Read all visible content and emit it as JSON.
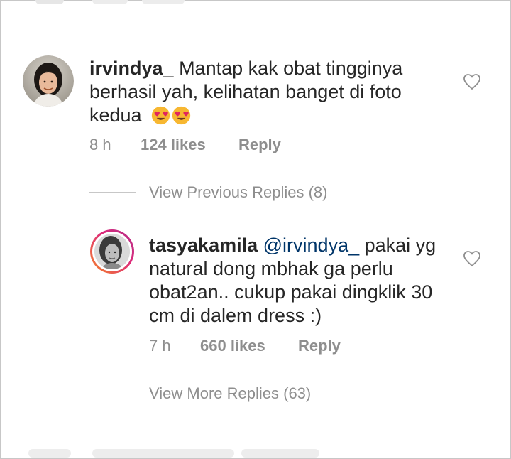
{
  "comments": [
    {
      "username": "irvindya_",
      "text_line1": " Mantap kak obat tingginya",
      "text_line2": "berhasil yah, kelihatan banget di foto",
      "text_line3": "kedua",
      "emojis": [
        "heart-eyes-emoji",
        "heart-eyes-emoji"
      ],
      "time": "8 h",
      "likes": "124 likes",
      "reply_label": "Reply",
      "avatar_icon": "profile-photo-woman"
    },
    {
      "username": "tasyakamila",
      "mention": "@irvindya_",
      "text_line1_rest": " pakai yg",
      "text_line2": "natural dong mbhak ga perlu",
      "text_line3": "obat2an.. cukup pakai dingklik 30",
      "text_line4": "cm di dalem dress :)",
      "time": "7 h",
      "likes": "660 likes",
      "reply_label": "Reply",
      "avatar_icon": "profile-photo-woman-bw-story-ring"
    }
  ],
  "view_previous_replies": "View Previous Replies (8)",
  "view_more_replies": "View More Replies (63)",
  "colors": {
    "text": "#262626",
    "meta": "#8e8e8e",
    "mention": "#003569",
    "story_ring_start": "#f58529",
    "story_ring_end": "#dd2a7b"
  }
}
